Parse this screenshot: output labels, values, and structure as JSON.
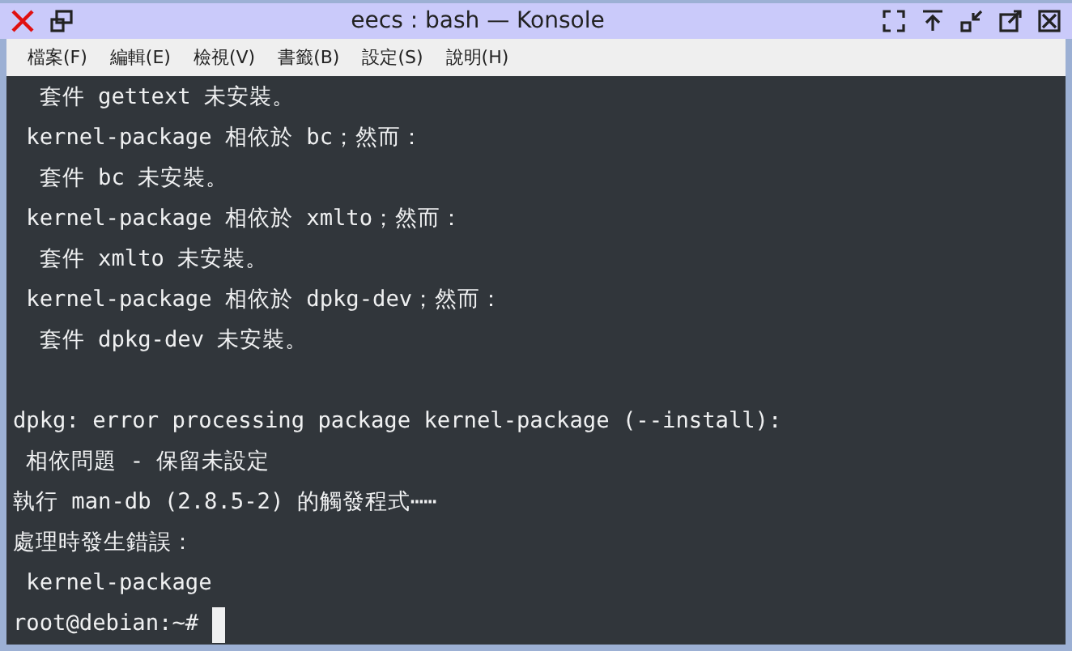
{
  "window": {
    "title": "eecs : bash — Konsole"
  },
  "menu": [
    "檔案(F)",
    "編輯(E)",
    "檢視(V)",
    "書籤(B)",
    "設定(S)",
    "說明(H)"
  ],
  "terminal": {
    "lines": [
      {
        "kind": "text",
        "text": "  套件 gettext 未安裝。"
      },
      {
        "kind": "text",
        "text": " kernel-package 相依於 bc；然而："
      },
      {
        "kind": "text",
        "text": "  套件 bc 未安裝。"
      },
      {
        "kind": "text",
        "text": " kernel-package 相依於 xmlto；然而："
      },
      {
        "kind": "text",
        "text": "  套件 xmlto 未安裝。"
      },
      {
        "kind": "text",
        "text": " kernel-package 相依於 dpkg-dev；然而："
      },
      {
        "kind": "text",
        "text": "  套件 dpkg-dev 未安裝。"
      },
      {
        "kind": "blank"
      },
      {
        "kind": "text",
        "text": "dpkg: error processing package kernel-package (--install):"
      },
      {
        "kind": "text",
        "text": " 相依問題 - 保留未設定"
      },
      {
        "kind": "text",
        "text": "執行 man-db (2.8.5-2) 的觸發程式⋯⋯"
      },
      {
        "kind": "text",
        "text": "處理時發生錯誤："
      },
      {
        "kind": "text",
        "text": " kernel-package"
      },
      {
        "kind": "prompt",
        "text": "root@debian:~# "
      }
    ]
  }
}
